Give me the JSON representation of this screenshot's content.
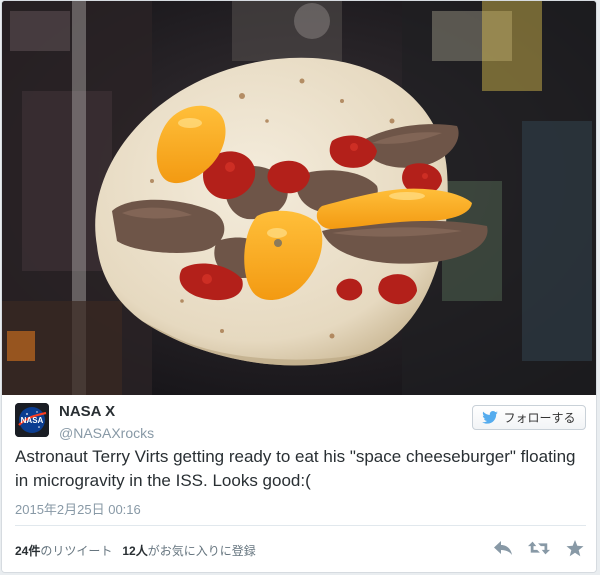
{
  "tweet": {
    "display_name": "NASA X",
    "screen_name": "@NASAXrocks",
    "avatar_text": "NASA",
    "text": "Astronaut Terry Virts getting ready to eat his \"space cheeseburger\" floating in microgravity in the ISS. Looks good:(",
    "timestamp": "2015年2月25日 00:16"
  },
  "follow_button": {
    "label": "フォローする",
    "icon": "twitter-bird-icon"
  },
  "stats": {
    "retweets_count": "24件",
    "retweets_label": "のリツイート",
    "favorites_count": "12人",
    "favorites_label": "がお気に入りに登録"
  },
  "actions": {
    "reply_icon": "reply-icon",
    "retweet_icon": "retweet-icon",
    "favorite_icon": "star-icon"
  },
  "colors": {
    "accent": "#55acee",
    "text": "#292f33",
    "muted": "#8899a6",
    "action_gray": "#8899a6"
  }
}
